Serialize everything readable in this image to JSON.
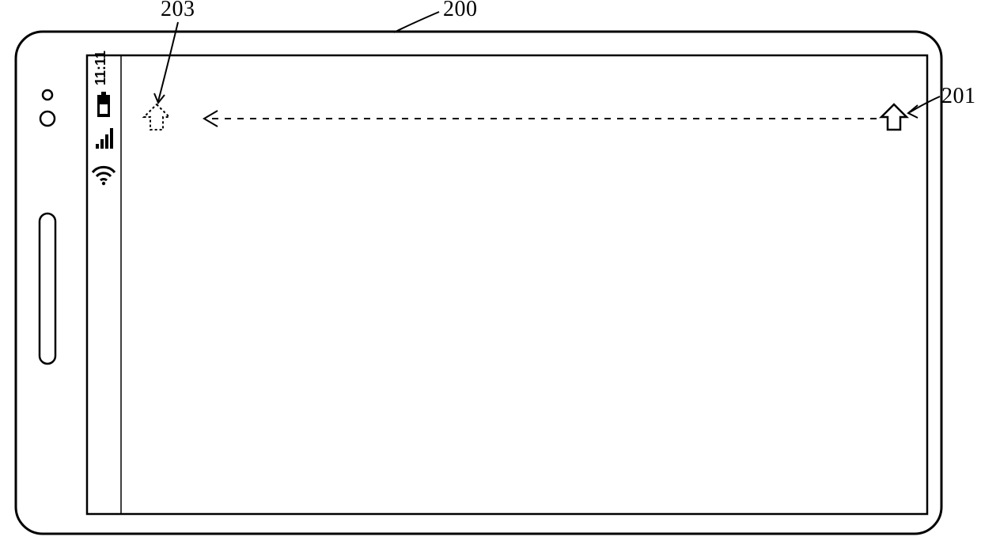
{
  "refs": {
    "device": "200",
    "home_target": "203",
    "home_source": "201"
  },
  "statusbar": {
    "time": "11:11"
  }
}
